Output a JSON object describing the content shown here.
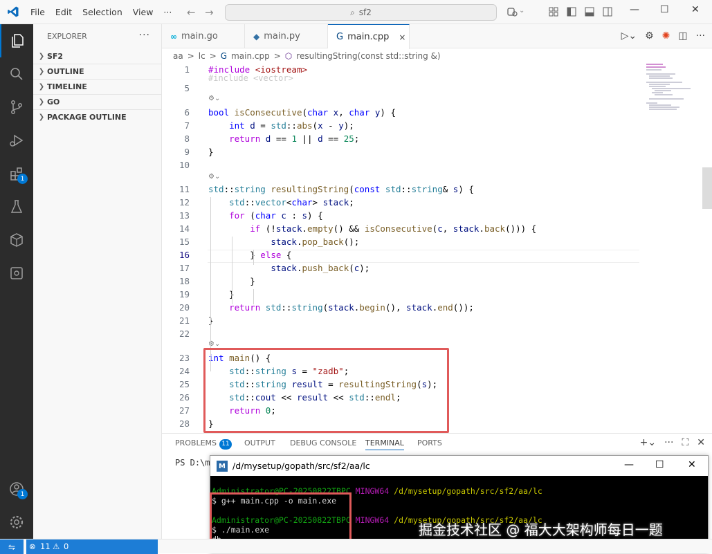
{
  "titlebar": {
    "menu": [
      "File",
      "Edit",
      "Selection",
      "View"
    ],
    "more": "···",
    "search": "sf2"
  },
  "activity_badges": {
    "extensions": "1",
    "accounts": "1"
  },
  "sidebar": {
    "title": "EXPLORER",
    "more": "···",
    "sections": [
      "SF2",
      "OUTLINE",
      "TIMELINE",
      "GO",
      "PACKAGE OUTLINE"
    ]
  },
  "tabs": [
    {
      "label": "main.go",
      "icon": "go-file-icon",
      "active": false
    },
    {
      "label": "main.py",
      "icon": "python-file-icon",
      "active": false
    },
    {
      "label": "main.cpp",
      "icon": "cpp-file-icon",
      "active": true
    }
  ],
  "tab_close": "×",
  "breadcrumb": {
    "parts": [
      "aa",
      "lc",
      "main.cpp",
      "resultingString(const std::string &)"
    ],
    "sep": ">"
  },
  "code": {
    "faded_text": "#include <vector>",
    "current_line": "16",
    "lines": [
      {
        "n": "1",
        "html": "<span class='ctl'>#include</span> <span class='str'>&lt;iostream&gt;</span>"
      },
      {
        "n": "5",
        "html": ""
      },
      {
        "n": "6",
        "html": "<span class='kw'>bool</span> <span class='fn'>isConsecutive</span>(<span class='kw'>char</span> <span class='var'>x</span>, <span class='kw'>char</span> <span class='var'>y</span>) {"
      },
      {
        "n": "7",
        "html": "    <span class='kw'>int</span> <span class='var'>d</span> = <span class='ns'>std</span>::<span class='fn'>abs</span>(<span class='var'>x</span> - <span class='var'>y</span>);"
      },
      {
        "n": "8",
        "html": "    <span class='ctl'>return</span> <span class='var'>d</span> == <span class='num'>1</span> || <span class='var'>d</span> == <span class='num'>25</span>;"
      },
      {
        "n": "9",
        "html": "}"
      },
      {
        "n": "10",
        "html": ""
      },
      {
        "n": "11",
        "html": "<span class='ns'>std</span>::<span class='ty'>string</span> <span class='fn'>resultingString</span>(<span class='kw'>const</span> <span class='ns'>std</span>::<span class='ty'>string</span>&amp; <span class='var'>s</span>) {"
      },
      {
        "n": "12",
        "html": "    <span class='ns'>std</span>::<span class='ty'>vector</span>&lt;<span class='kw'>char</span>&gt; <span class='var'>stack</span>;"
      },
      {
        "n": "13",
        "html": "    <span class='ctl'>for</span> (<span class='kw'>char</span> <span class='var'>c</span> : <span class='var'>s</span>) {"
      },
      {
        "n": "14",
        "html": "        <span class='ctl'>if</span> (!<span class='var'>stack</span>.<span class='fn'>empty</span>() &amp;&amp; <span class='fn'>isConsecutive</span>(<span class='var'>c</span>, <span class='var'>stack</span>.<span class='fn'>back</span>())) {"
      },
      {
        "n": "15",
        "html": "            <span class='var'>stack</span>.<span class='fn'>pop_back</span>();"
      },
      {
        "n": "16",
        "html": "        } <span class='ctl'>else</span> {"
      },
      {
        "n": "17",
        "html": "            <span class='var'>stack</span>.<span class='fn'>push_back</span>(<span class='var'>c</span>);"
      },
      {
        "n": "18",
        "html": "        }"
      },
      {
        "n": "19",
        "html": "    }"
      },
      {
        "n": "20",
        "html": "    <span class='ctl'>return</span> <span class='ns'>std</span>::<span class='ty'>string</span>(<span class='var'>stack</span>.<span class='fn'>begin</span>(), <span class='var'>stack</span>.<span class='fn'>end</span>());"
      },
      {
        "n": "21",
        "html": "}"
      },
      {
        "n": "22",
        "html": ""
      },
      {
        "n": "23",
        "html": "<span class='kw'>int</span> <span class='fn'>main</span>() {"
      },
      {
        "n": "24",
        "html": "    <span class='ns'>std</span>::<span class='ty'>string</span> <span class='var'>s</span> = <span class='str'>\"zadb\"</span>;"
      },
      {
        "n": "25",
        "html": "    <span class='ns'>std</span>::<span class='ty'>string</span> <span class='var'>result</span> = <span class='fn'>resultingString</span>(<span class='var'>s</span>);"
      },
      {
        "n": "26",
        "html": "    <span class='ns'>std</span>::<span class='var'>cout</span> &lt;&lt; <span class='var'>result</span> &lt;&lt; <span class='ns'>std</span>::<span class='fn'>endl</span>;"
      },
      {
        "n": "27",
        "html": "    <span class='ctl'>return</span> <span class='num'>0</span>;"
      },
      {
        "n": "28",
        "html": "}"
      }
    ]
  },
  "panel": {
    "tabs": [
      "PROBLEMS",
      "OUTPUT",
      "DEBUG CONSOLE",
      "TERMINAL",
      "PORTS"
    ],
    "active_tab": "TERMINAL",
    "problems_count": "11",
    "prompt": "PS D:\\m"
  },
  "mintty": {
    "title": "/d/mysetup/gopath/src/sf2/aa/lc",
    "user": "Administrator@PC-20250822TBPC",
    "shell": "MINGW64",
    "path": "/d/mysetup/gopath/src/sf2/aa/lc",
    "cmd1": "g++ main.cpp -o main.exe",
    "cmd2": "./main.exe",
    "output": "db",
    "prompt_char": "$"
  },
  "watermark": "掘金技术社区 @ 福大大架构师每日一题",
  "status": {
    "errors": "11",
    "warnings": "0"
  }
}
